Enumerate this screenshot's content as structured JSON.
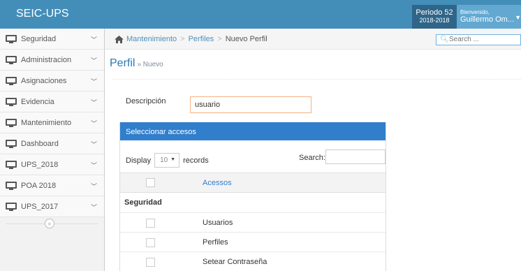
{
  "app": {
    "title": "SEIC-UPS"
  },
  "period": {
    "label": "Periodo 52",
    "years": "2018-2018"
  },
  "user": {
    "greeting": "Bienvenido,",
    "name": "Guillermo Om..."
  },
  "sidebar": {
    "items": [
      {
        "label": "Seguridad"
      },
      {
        "label": "Administracion"
      },
      {
        "label": "Asignaciones"
      },
      {
        "label": "Evidencia"
      },
      {
        "label": "Mantenimiento"
      },
      {
        "label": "Dashboard"
      },
      {
        "label": "UPS_2018"
      },
      {
        "label": "POA 2018"
      },
      {
        "label": "UPS_2017"
      }
    ]
  },
  "breadcrumb": {
    "items": [
      "Mantenimiento",
      "Perfiles"
    ],
    "active": "Nuevo Perfil"
  },
  "search": {
    "placeholder": "Search ..."
  },
  "page": {
    "title": "Perfil",
    "subtitle": "Nuevo"
  },
  "form": {
    "descripcion_label": "Descripción",
    "descripcion_value": "usuario"
  },
  "panel": {
    "title": "Seleccionar accesos",
    "display_label": "Display",
    "records_value": "10",
    "records_label": "records",
    "search_label": "Search:",
    "column_header": "Acessos",
    "group": "Seguridad",
    "rows": [
      {
        "label": "Usuarios"
      },
      {
        "label": "Perfiles"
      },
      {
        "label": "Setear Contraseña"
      }
    ]
  },
  "colors": {
    "topbar": "#438eb9",
    "panel_header": "#307ecc",
    "link": "#4c8fbd"
  }
}
